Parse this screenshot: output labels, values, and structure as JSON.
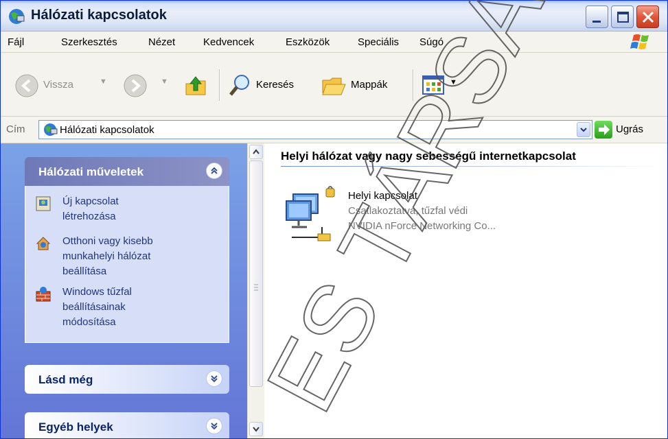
{
  "window": {
    "title": "Hálózati kapcsolatok"
  },
  "menu": [
    "Fájl",
    "Szerkesztés",
    "Nézet",
    "Kedvencek",
    "Eszközök",
    "Speciális",
    "Súgó"
  ],
  "toolbar": {
    "back_label": "Vissza",
    "search_label": "Keresés",
    "folders_label": "Mappák"
  },
  "address": {
    "label": "Cím",
    "value": "Hálózati kapcsolatok",
    "go_label": "Ugrás"
  },
  "tasks": {
    "network_tasks": {
      "title": "Hálózati műveletek",
      "links": [
        [
          "Új kapcsolat",
          "létrehozása"
        ],
        [
          "Otthoni vagy kisebb",
          "munkahelyi hálózat",
          "beállítása"
        ],
        [
          "Windows tűzfal",
          "beállításainak",
          "módosítása"
        ]
      ]
    },
    "see_also": {
      "title": "Lásd még"
    },
    "other_places": {
      "title": "Egyéb helyek"
    }
  },
  "content": {
    "group_title": "Helyi hálózat vagy nagy sebességű internetkapcsolat",
    "connection": {
      "name": "Helyi kapcsolat",
      "status": "Csatlakoztatva, tűzfal védi",
      "device": "NVIDIA nForce Networking Co..."
    }
  },
  "watermark": {
    "text": "ES TÁRSA"
  }
}
